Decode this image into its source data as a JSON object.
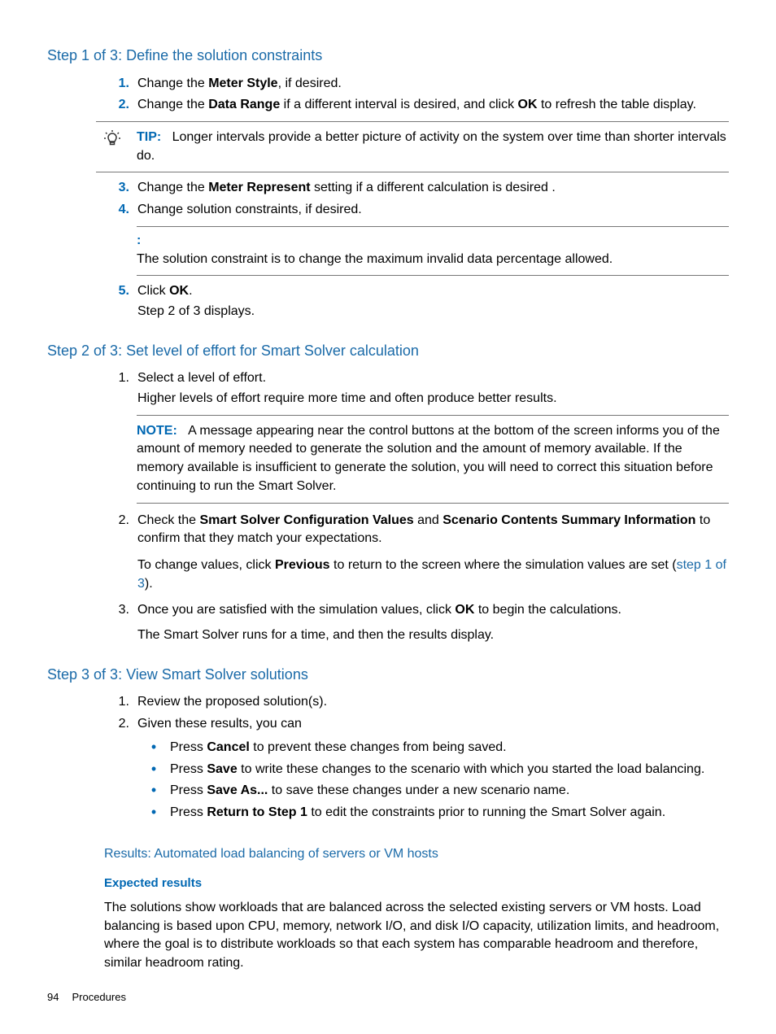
{
  "step1": {
    "heading": "Step 1 of 3: Define the solution constraints",
    "item1": {
      "num": "1.",
      "pre": "Change the ",
      "b": "Meter Style",
      "post": ", if desired."
    },
    "item2": {
      "num": "2.",
      "pre": "Change the ",
      "b1": "Data Range",
      "mid": " if a different interval is desired, and click ",
      "b2": "OK",
      "post": " to refresh the table display."
    },
    "tip": {
      "label": "TIP:",
      "text": "Longer intervals provide a better picture of activity on the system over time than shorter intervals do."
    },
    "item3": {
      "num": "3.",
      "pre": "Change the ",
      "b": "Meter Represent",
      "post": " setting if a different calculation is desired ."
    },
    "item4": {
      "num": "4.",
      "text": "Change solution constraints, if desired."
    },
    "colon": {
      "label": ":",
      "text": "The solution constraint is to change the maximum invalid data percentage allowed."
    },
    "item5": {
      "num": "5.",
      "pre": "Click ",
      "b": "OK",
      "post": ".",
      "sub": "Step 2 of 3 displays."
    }
  },
  "step2": {
    "heading": "Step 2 of 3: Set level of effort for Smart Solver calculation",
    "item1": {
      "num": "1.",
      "text": "Select a level of effort.",
      "sub": "Higher levels of effort require more time and often produce better results."
    },
    "note": {
      "label": "NOTE:",
      "text": "A message appearing near the control buttons at the bottom of the screen informs you of the amount of memory needed to generate the solution and the amount of memory available. If the memory available is insufficient to generate the solution, you will need to correct this situation before continuing to run the Smart Solver."
    },
    "item2": {
      "num": "2.",
      "l1_pre": "Check the ",
      "l1_b1": "Smart Solver Configuration Values",
      "l1_mid": " and ",
      "l1_b2": "Scenario Contents Summary Information",
      "l1_post": " to confirm that they match your expectations.",
      "l2_pre": "To change values, click ",
      "l2_b": "Previous",
      "l2_mid": " to return to the screen where the simulation values are set (",
      "l2_link": "step 1 of 3",
      "l2_post": ")."
    },
    "item3": {
      "num": "3.",
      "pre": "Once you are satisfied with the simulation values, click ",
      "b": "OK",
      "post": " to begin the calculations.",
      "sub": "The Smart Solver runs for a time, and then the results display."
    }
  },
  "step3": {
    "heading": "Step 3 of 3: View Smart Solver solutions",
    "item1": {
      "num": "1.",
      "text": "Review the proposed solution(s)."
    },
    "item2": {
      "num": "2.",
      "text": "Given these results, you can"
    },
    "b1": {
      "pre": "Press ",
      "b": "Cancel",
      "post": " to prevent these changes from being saved."
    },
    "b2": {
      "pre": "Press ",
      "b": "Save",
      "post": " to write these changes to the scenario with which you started the load balancing."
    },
    "b3": {
      "pre": "Press ",
      "b": "Save As...",
      "post": " to save these changes under a new scenario name."
    },
    "b4": {
      "pre": "Press ",
      "b": "Return to Step 1",
      "post": " to edit the constraints prior to running the Smart Solver again."
    }
  },
  "results": {
    "heading": "Results: Automated load balancing of servers or VM hosts",
    "sub": "Expected results",
    "text": "The solutions show workloads that are balanced across the selected existing servers or VM hosts. Load balancing is based upon CPU, memory, network I/O, and disk I/O capacity, utilization limits, and headroom, where the goal is to distribute workloads so that each system has comparable headroom and therefore, similar headroom rating."
  },
  "footer": {
    "page": "94",
    "section": "Procedures"
  }
}
